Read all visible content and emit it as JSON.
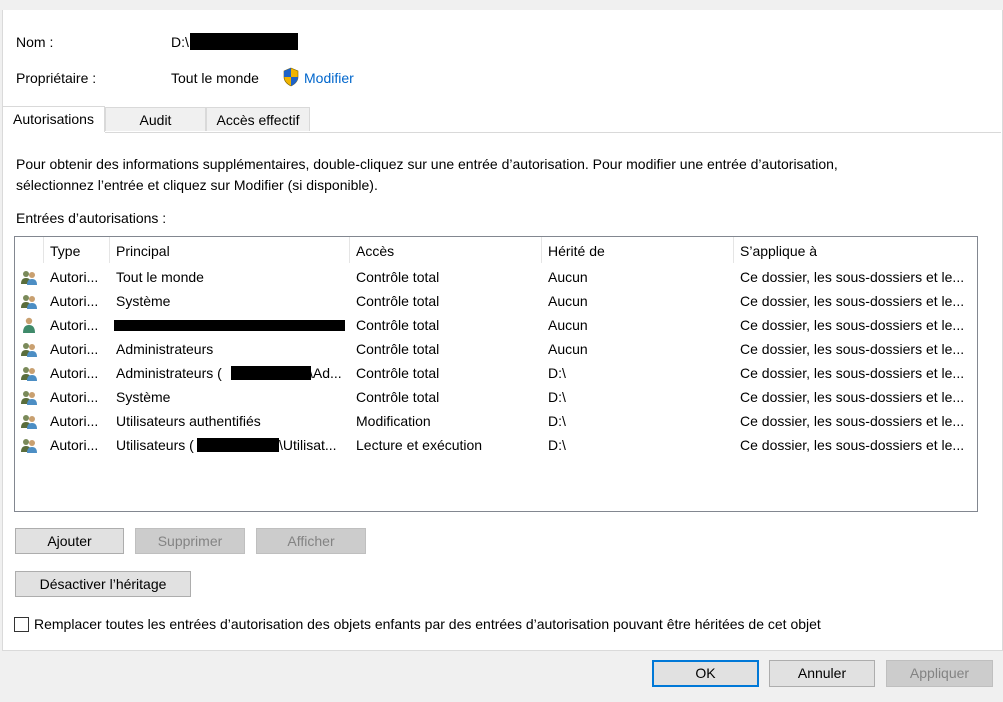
{
  "header": {
    "name_label": "Nom :",
    "name_value": "D:\\",
    "owner_label": "Propriétaire :",
    "owner_value": "Tout le monde",
    "modify_link": "Modifier"
  },
  "tabs": [
    {
      "label": "Autorisations",
      "active": true
    },
    {
      "label": "Audit",
      "active": false
    },
    {
      "label": "Accès effectif",
      "active": false
    }
  ],
  "info_text_line1": "Pour obtenir des informations supplémentaires, double-cliquez sur une entrée d’autorisation. Pour modifier une entrée d’autorisation,",
  "info_text_line2": "sélectionnez l’entrée et cliquez sur Modifier (si disponible).",
  "entries_label": "Entrées d’autorisations :",
  "columns": [
    "Type",
    "Principal",
    "Accès",
    "Hérité de",
    "S’applique à"
  ],
  "rows": [
    {
      "type": "Autori...",
      "principal": "Tout le monde",
      "access": "Contrôle total",
      "inherited": "Aucun",
      "applies": "Ce dossier, les sous-dossiers et le...",
      "icon": "group-icon"
    },
    {
      "type": "Autori...",
      "principal": "Système",
      "access": "Contrôle total",
      "inherited": "Aucun",
      "applies": "Ce dossier, les sous-dossiers et le...",
      "icon": "group-icon"
    },
    {
      "type": "Autori...",
      "principal": "",
      "access": "Contrôle total",
      "inherited": "Aucun",
      "applies": "Ce dossier, les sous-dossiers et le...",
      "icon": "user-icon"
    },
    {
      "type": "Autori...",
      "principal": "Administrateurs",
      "access": "Contrôle total",
      "inherited": "Aucun",
      "applies": "Ce dossier, les sous-dossiers et le...",
      "icon": "group-icon"
    },
    {
      "type": "Autori...",
      "principal": "Administrateurs (",
      "principal_suffix": "\\Ad...",
      "access": "Contrôle total",
      "inherited": "D:\\",
      "applies": "Ce dossier, les sous-dossiers et le...",
      "icon": "group-icon"
    },
    {
      "type": "Autori...",
      "principal": "Système",
      "access": "Contrôle total",
      "inherited": "D:\\",
      "applies": "Ce dossier, les sous-dossiers et le...",
      "icon": "group-icon"
    },
    {
      "type": "Autori...",
      "principal": "Utilisateurs authentifiés",
      "access": "Modification",
      "inherited": "D:\\",
      "applies": "Ce dossier, les sous-dossiers et le...",
      "icon": "group-icon"
    },
    {
      "type": "Autori...",
      "principal": "Utilisateurs (",
      "principal_suffix": "\\Utilisat...",
      "access": "Lecture et exécution",
      "inherited": "D:\\",
      "applies": "Ce dossier, les sous-dossiers et le...",
      "icon": "group-icon"
    }
  ],
  "buttons": {
    "add": "Ajouter",
    "remove": "Supprimer",
    "view": "Afficher",
    "disable_inheritance": "Désactiver l’héritage",
    "ok": "OK",
    "cancel": "Annuler",
    "apply": "Appliquer"
  },
  "replace_checkbox_label": "Remplacer toutes les entrées d’autorisation des objets enfants par des entrées d’autorisation pouvant être héritées de cet objet",
  "colors": {
    "link": "#0066cc",
    "focus_border": "#0078d7",
    "disabled_button": "#cccccc"
  }
}
